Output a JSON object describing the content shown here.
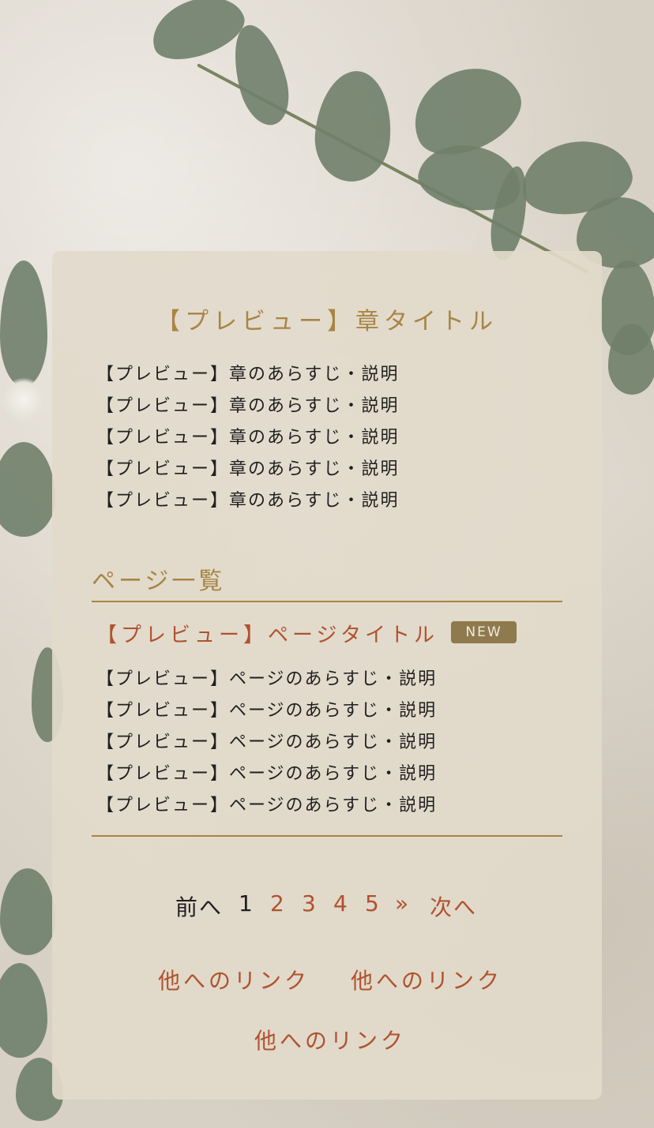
{
  "chapter": {
    "title": "【プレビュー】章タイトル",
    "descriptions": [
      "【プレビュー】章のあらすじ・説明",
      "【プレビュー】章のあらすじ・説明",
      "【プレビュー】章のあらすじ・説明",
      "【プレビュー】章のあらすじ・説明",
      "【プレビュー】章のあらすじ・説明"
    ]
  },
  "page_list": {
    "heading": "ページ一覧",
    "page": {
      "title": "【プレビュー】ページタイトル",
      "badge": "NEW",
      "descriptions": [
        "【プレビュー】ページのあらすじ・説明",
        "【プレビュー】ページのあらすじ・説明",
        "【プレビュー】ページのあらすじ・説明",
        "【プレビュー】ページのあらすじ・説明",
        "【プレビュー】ページのあらすじ・説明"
      ]
    }
  },
  "pagination": {
    "prev": "前へ",
    "pages": [
      "1",
      "2",
      "3",
      "4",
      "5"
    ],
    "current": "1",
    "forward": "»",
    "next": "次へ"
  },
  "links": [
    "他へのリンク",
    "他へのリンク",
    "他へのリンク"
  ],
  "colors": {
    "accent_gold": "#a88544",
    "link_red": "#b0522f",
    "badge_bg": "#8e7a4d",
    "panel_bg": "#e2dacb"
  }
}
